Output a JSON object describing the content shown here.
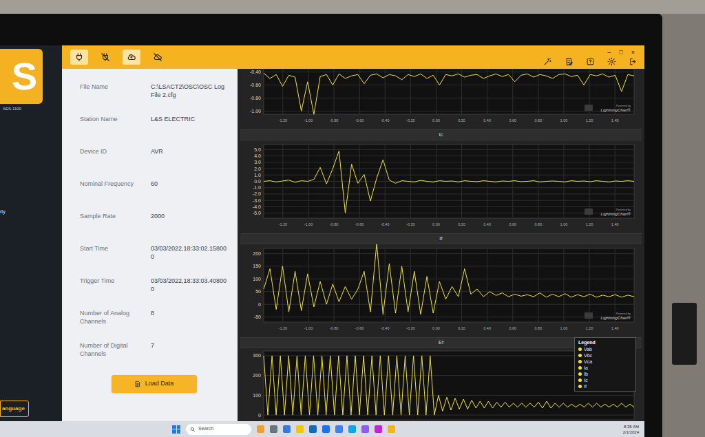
{
  "window": {
    "controls": [
      "–",
      "□",
      "×"
    ]
  },
  "sidebar": {
    "logo": "S",
    "model": "AES-1100",
    "items": [
      {
        "label": "rty"
      }
    ],
    "language_button": "anguage"
  },
  "toolbar": {
    "left": [
      {
        "selected": true
      },
      {
        "selected": false
      },
      {
        "selected": true
      },
      {
        "selected": false
      }
    ]
  },
  "info": {
    "fields": [
      {
        "label": "File Name",
        "value": "C:\\LSACT2\\OSC\\OSC Log File 2.cfg"
      },
      {
        "label": "Station Name",
        "value": "L&S ELECTRIC"
      },
      {
        "label": "Device ID",
        "value": "AVR"
      },
      {
        "label": "Nominal Frequency",
        "value": "60"
      },
      {
        "label": "Sample Rate",
        "value": "2000"
      },
      {
        "label": "Start Time",
        "value": "03/03/2022,18:33:02.158000"
      },
      {
        "label": "Trigger Time",
        "value": "03/03/2022,18:33:03.408000"
      },
      {
        "label": "Number of Analog Channels",
        "value": "8"
      },
      {
        "label": "Number of Digital Channels",
        "value": "7"
      }
    ],
    "button": "Load Data"
  },
  "charts": [
    {
      "y_ticks": [
        "-0.40",
        "-0.60",
        "-0.80",
        "-1.00"
      ],
      "x_ticks": [
        "-1.20",
        "-1.00",
        "-0.80",
        "-0.60",
        "-0.40",
        "-0.20",
        "0.00",
        "0.20",
        "0.40",
        "0.60",
        "0.80",
        "1.00",
        "1.20",
        "1.40"
      ],
      "series": [
        -0.42,
        -0.5,
        -0.44,
        -0.62,
        -0.45,
        -0.48,
        -1.0,
        -0.55,
        -1.05,
        -0.47,
        -0.44,
        -0.6,
        -0.43,
        -0.5,
        -0.46,
        -0.44,
        -0.58,
        -0.45,
        -0.43,
        -0.49,
        -0.44,
        -0.46,
        -0.52,
        -0.44,
        -0.47,
        -0.43,
        -0.5,
        -0.45,
        -0.6,
        -0.44,
        -0.46,
        -0.43,
        -0.48,
        -0.45,
        -0.44,
        -0.5,
        -0.46,
        -0.43,
        -0.47,
        -0.44,
        -0.55,
        -0.45,
        -0.43,
        -0.48,
        -0.44,
        -0.46,
        -0.5,
        -0.44,
        -0.43,
        -0.47,
        -0.45,
        -0.6,
        -0.44,
        -0.46,
        -0.43,
        -0.48,
        -0.45,
        -0.7,
        -0.44,
        -0.46
      ]
    },
    {
      "title": "Ic",
      "y_ticks": [
        "5.0",
        "4.0",
        "3.0",
        "2.0",
        "1.0",
        "0.0",
        "-1.0",
        "-2.0",
        "-3.0",
        "-4.0",
        "-5.0"
      ],
      "x_ticks": [
        "-1.20",
        "-1.00",
        "-0.80",
        "-0.60",
        "-0.40",
        "-0.20",
        "0.00",
        "0.20",
        "0.40",
        "0.60",
        "0.80",
        "1.00",
        "1.20",
        "1.40"
      ],
      "series": [
        0,
        0.1,
        -0.1,
        0.05,
        0.2,
        -0.15,
        0.1,
        0,
        0.3,
        2.2,
        -0.4,
        2.0,
        4.8,
        -5.0,
        2.7,
        -0.3,
        1.1,
        -3.1,
        0.5,
        3.4,
        0.2,
        -0.3,
        0.1,
        0,
        -0.1,
        0.15,
        0,
        -0.1,
        0.1,
        0,
        0.05,
        -0.1,
        0.1,
        0,
        -0.05,
        0.1,
        0,
        -0.1,
        0.05,
        0,
        0.1,
        -0.05,
        0,
        0.1,
        -0.1,
        0,
        0.05,
        0,
        -0.1,
        0.1,
        0,
        0.05,
        -0.05,
        0.1,
        0,
        -0.1,
        0.05,
        0,
        0.1,
        0
      ]
    },
    {
      "title": "If",
      "y_ticks": [
        "200",
        "150",
        "100",
        "50",
        "0",
        "-50"
      ],
      "x_ticks": [
        "-1.20",
        "-1.00",
        "-0.80",
        "-0.60",
        "-0.40",
        "-0.20",
        "0.00",
        "0.20",
        "0.40",
        "0.60",
        "0.80",
        "1.00",
        "1.20",
        "1.40"
      ],
      "series": [
        60,
        140,
        -20,
        150,
        -30,
        130,
        -25,
        120,
        -10,
        90,
        0,
        80,
        10,
        70,
        20,
        60,
        130,
        -30,
        240,
        -40,
        160,
        -35,
        150,
        -30,
        130,
        -40,
        110,
        -35,
        90,
        20,
        70,
        30,
        140,
        40,
        60,
        30,
        50,
        35,
        45,
        30,
        40,
        32,
        38,
        30,
        45,
        28,
        40,
        30,
        42,
        28,
        38,
        30,
        40,
        28,
        36,
        30,
        38,
        28,
        36,
        30
      ]
    },
    {
      "title": "Ef",
      "y_ticks": [
        "300",
        "200",
        "100",
        "0"
      ],
      "series": [
        300,
        0,
        300,
        0,
        300,
        0,
        300,
        0,
        300,
        0,
        300,
        0,
        300,
        0,
        300,
        0,
        300,
        0,
        300,
        0,
        300,
        0,
        300,
        0,
        300,
        0,
        300,
        0,
        300,
        0,
        300,
        0,
        300,
        0,
        300,
        0,
        300,
        0,
        300,
        0,
        300,
        0,
        100,
        20,
        90,
        25,
        85,
        30,
        80,
        30,
        75,
        35,
        70,
        35,
        70,
        35,
        65,
        40,
        65,
        40,
        60,
        40,
        60,
        40,
        60,
        40,
        65,
        35,
        70,
        35,
        60,
        40,
        60,
        40,
        55,
        40,
        55,
        40,
        60,
        40,
        60,
        40,
        55,
        40,
        55,
        40,
        60,
        40,
        55,
        40
      ]
    }
  ],
  "chart_credit": {
    "powered": "Powered by",
    "brand": "LightningChart®"
  },
  "legend": {
    "title": "Legend",
    "items": [
      "Vab",
      "Vbc",
      "Vca",
      "Ia",
      "Ib",
      "Ic",
      "If"
    ]
  },
  "taskbar": {
    "search": "Search",
    "time": "8:35 AM",
    "date": "2/1/2024"
  }
}
